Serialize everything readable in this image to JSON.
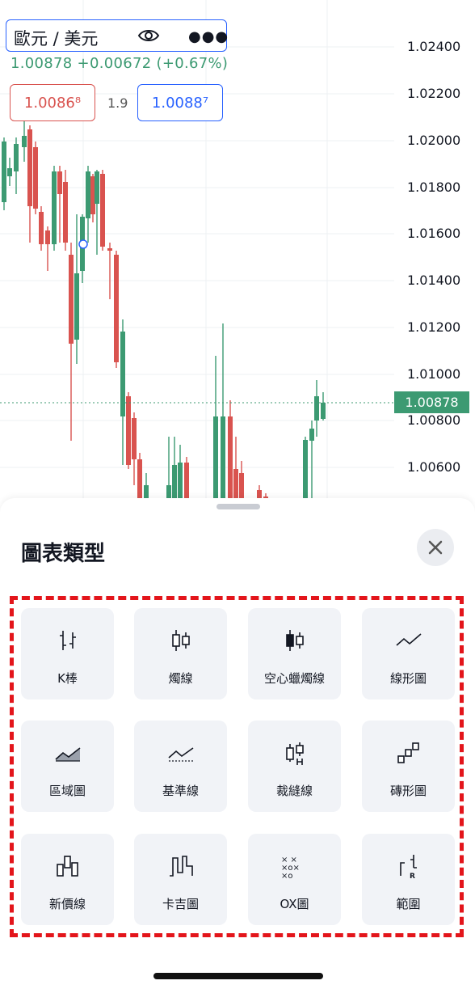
{
  "header": {
    "symbol": "歐元 / 美元",
    "price_change": "1.00878 +0.00672 (+0.67%)",
    "sell_price": "1.0086⁸",
    "spread": "1.9",
    "buy_price": "1.0088⁷"
  },
  "chart": {
    "y_axis_labels": [
      "1.02400",
      "1.02200",
      "1.02000",
      "1.01800",
      "1.01600",
      "1.01400",
      "1.01200",
      "1.01000",
      "1.00800",
      "1.00600"
    ],
    "last_price": "1.00878",
    "colors": {
      "up": "#3c9a72",
      "down": "#d9534f"
    }
  },
  "sheet": {
    "title": "圖表類型",
    "close_icon": "close-icon",
    "chart_types": [
      {
        "label": "K棒",
        "icon": "bars-icon"
      },
      {
        "label": "燭線",
        "icon": "candles-icon"
      },
      {
        "label": "空心蠟燭線",
        "icon": "hollow-candles-icon"
      },
      {
        "label": "線形圖",
        "icon": "line-icon"
      },
      {
        "label": "區域圖",
        "icon": "area-icon"
      },
      {
        "label": "基準線",
        "icon": "baseline-icon"
      },
      {
        "label": "裁縫線",
        "icon": "hlc-icon"
      },
      {
        "label": "磚形圖",
        "icon": "renko-icon"
      },
      {
        "label": "新價線",
        "icon": "line-break-icon"
      },
      {
        "label": "卡吉圖",
        "icon": "kagi-icon"
      },
      {
        "label": "OX圖",
        "icon": "point-figure-icon"
      },
      {
        "label": "範圍",
        "icon": "range-icon"
      }
    ]
  }
}
